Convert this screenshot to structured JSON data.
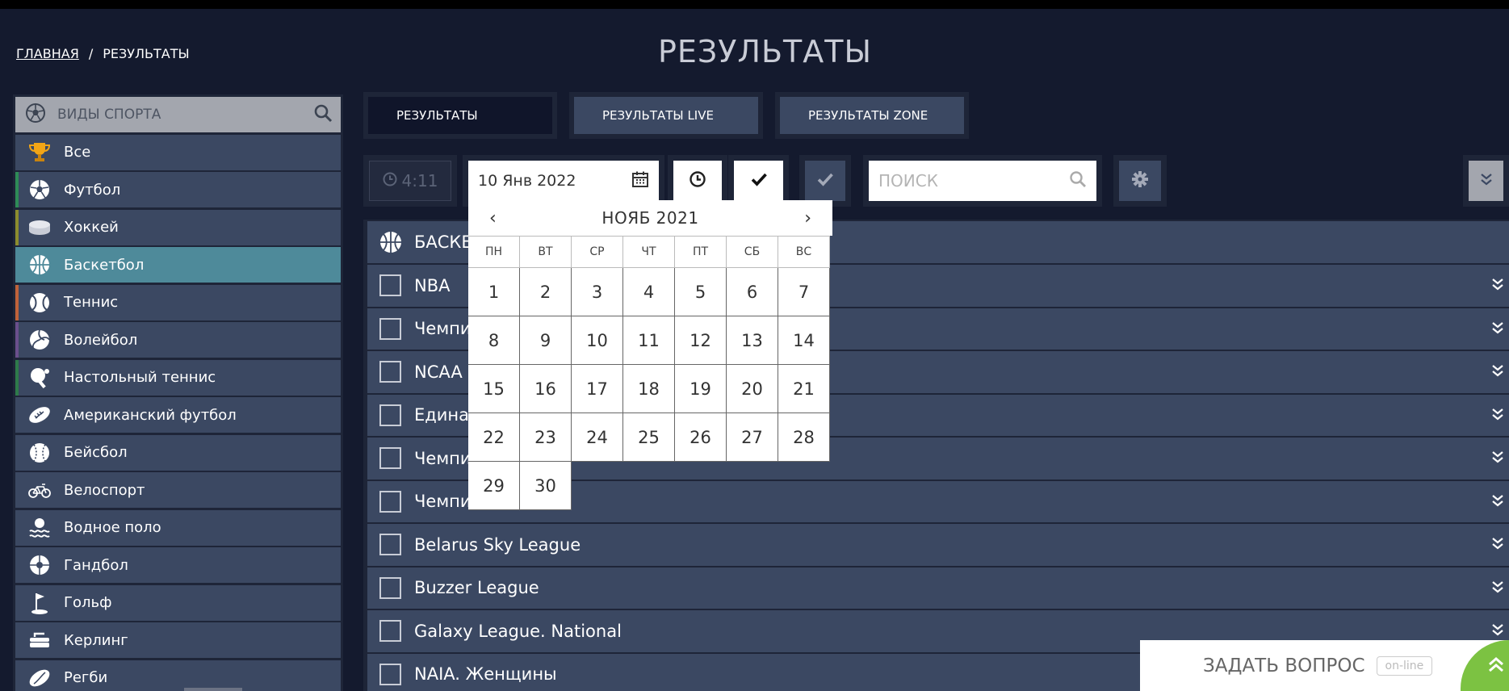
{
  "breadcrumb": {
    "home": "ГЛАВНАЯ",
    "separator": "/",
    "current": "РЕЗУЛЬТАТЫ"
  },
  "page_title": "РЕЗУЛЬТАТЫ",
  "sidebar": {
    "search_label": "ВИДЫ СПОРТА",
    "items": [
      {
        "label": "Все",
        "icon": "trophy-icon",
        "accent": "#3b4862"
      },
      {
        "label": "Футбол",
        "icon": "football-icon",
        "accent": "#2e8b57"
      },
      {
        "label": "Хоккей",
        "icon": "hockey-puck-icon",
        "accent": "#8c8c2e"
      },
      {
        "label": "Баскетбол",
        "icon": "basketball-icon",
        "accent": "#4e8a9a"
      },
      {
        "label": "Теннис",
        "icon": "tennis-icon",
        "accent": "#c0623a"
      },
      {
        "label": "Волейбол",
        "icon": "volleyball-icon",
        "accent": "#6a4f8c"
      },
      {
        "label": "Настольный теннис",
        "icon": "table-tennis-icon",
        "accent": "#2e7a4a"
      },
      {
        "label": "Американский футбол",
        "icon": "american-football-icon",
        "accent": "#3b4862"
      },
      {
        "label": "Бейсбол",
        "icon": "baseball-icon",
        "accent": "#3b4862"
      },
      {
        "label": "Велоспорт",
        "icon": "bicycle-icon",
        "accent": "#3b4862"
      },
      {
        "label": "Водное поло",
        "icon": "water-polo-icon",
        "accent": "#3b4862"
      },
      {
        "label": "Гандбол",
        "icon": "handball-icon",
        "accent": "#3b4862"
      },
      {
        "label": "Гольф",
        "icon": "golf-icon",
        "accent": "#3b4862"
      },
      {
        "label": "Керлинг",
        "icon": "curling-icon",
        "accent": "#3b4862"
      },
      {
        "label": "Регби",
        "icon": "rugby-icon",
        "accent": "#3b4862"
      }
    ]
  },
  "tabs": [
    {
      "label": "РЕЗУЛЬТАТЫ",
      "active": true
    },
    {
      "label": "РЕЗУЛЬТАТЫ LIVE",
      "active": false
    },
    {
      "label": "РЕЗУЛЬТАТЫ ZONE",
      "active": false
    }
  ],
  "toolbar": {
    "time": "4:11",
    "date": "10 Янв 2022",
    "search_placeholder": "ПОИСК"
  },
  "results": {
    "sport": "БАСКЕТ",
    "leagues": [
      "NBA",
      "Чемпи",
      "NCAA",
      "Единая",
      "Чемпи",
      "Чемпи",
      "Belarus Sky League",
      "Buzzer League",
      "Galaxy League. National",
      "NAIA. Женщины"
    ]
  },
  "datepicker": {
    "month": "НОЯБ 2021",
    "prev": "‹",
    "next": "›",
    "weekdays": [
      "ПН",
      "ВТ",
      "СР",
      "ЧТ",
      "ПТ",
      "СБ",
      "ВС"
    ],
    "days": [
      "1",
      "2",
      "3",
      "4",
      "5",
      "6",
      "7",
      "8",
      "9",
      "10",
      "11",
      "12",
      "13",
      "14",
      "15",
      "16",
      "17",
      "18",
      "19",
      "20",
      "21",
      "22",
      "23",
      "24",
      "25",
      "26",
      "27",
      "28",
      "29",
      "30"
    ]
  },
  "chat": {
    "label": "ЗАДАТЬ ВОПРОС",
    "status": "on-line"
  },
  "colors": {
    "bg": "#141a2e",
    "panel": "#3b4862",
    "active": "#4e8a9a",
    "chat_accent": "#7cc242"
  }
}
